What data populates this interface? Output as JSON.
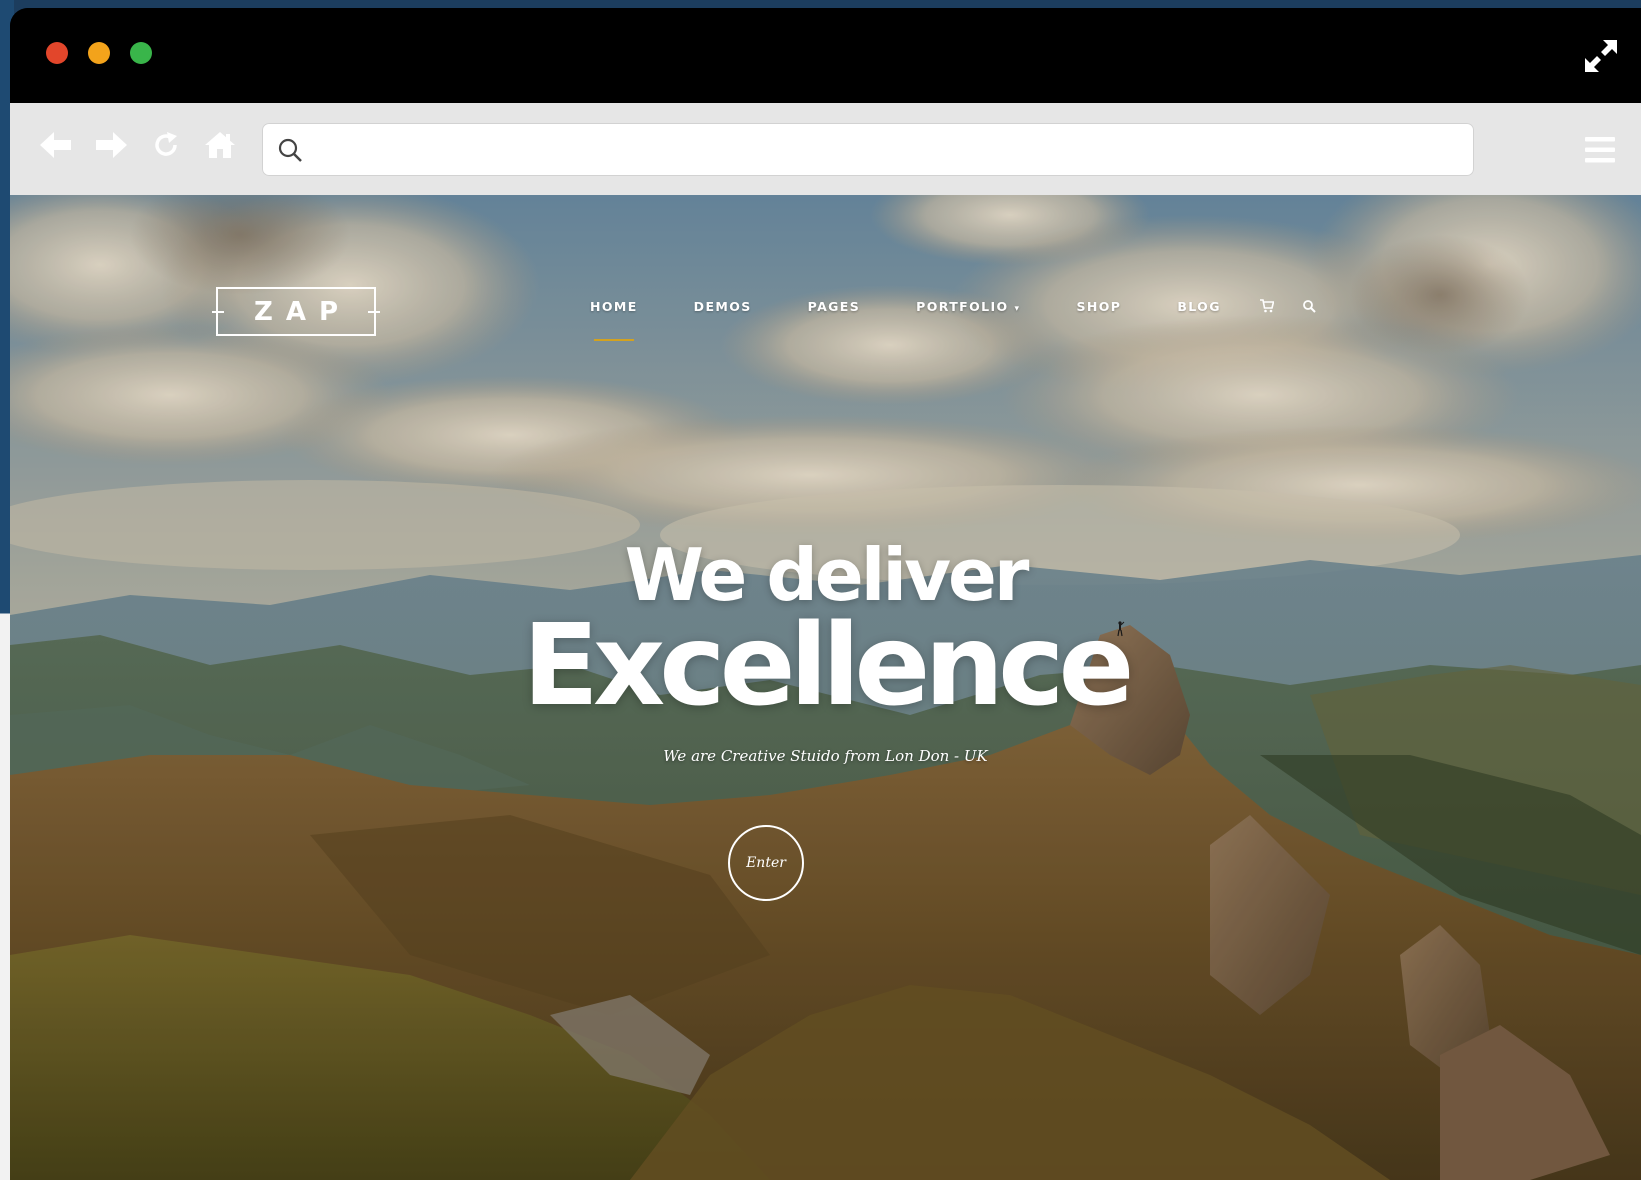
{
  "browser": {
    "address_bar": {
      "value": "",
      "placeholder": ""
    },
    "icons": {
      "back": "arrow-left-icon",
      "forward": "arrow-right-icon",
      "reload": "reload-icon",
      "home": "home-icon",
      "search": "search-icon",
      "menu": "hamburger-menu-icon",
      "expand": "expand-icon"
    },
    "traffic_lights": {
      "close": "#e2462b",
      "minimize": "#f3a31b",
      "maximize": "#39b54a"
    }
  },
  "site": {
    "logo": "ZAP",
    "nav": [
      {
        "label": "HOME",
        "active": true
      },
      {
        "label": "DEMOS",
        "active": false
      },
      {
        "label": "PAGES",
        "active": false
      },
      {
        "label": "PORTFOLIO",
        "active": false,
        "has_dropdown": true
      },
      {
        "label": "SHOP",
        "active": false
      },
      {
        "label": "BLOG",
        "active": false
      }
    ],
    "nav_icons": {
      "cart": "cart-icon",
      "search": "search-icon"
    },
    "accent_color": "#d3a21f",
    "hero": {
      "line1": "We deliver",
      "line2": "Excellence",
      "subtitle": "We are Creative Stuido from Lon Don - UK",
      "button_label": "Enter"
    }
  }
}
